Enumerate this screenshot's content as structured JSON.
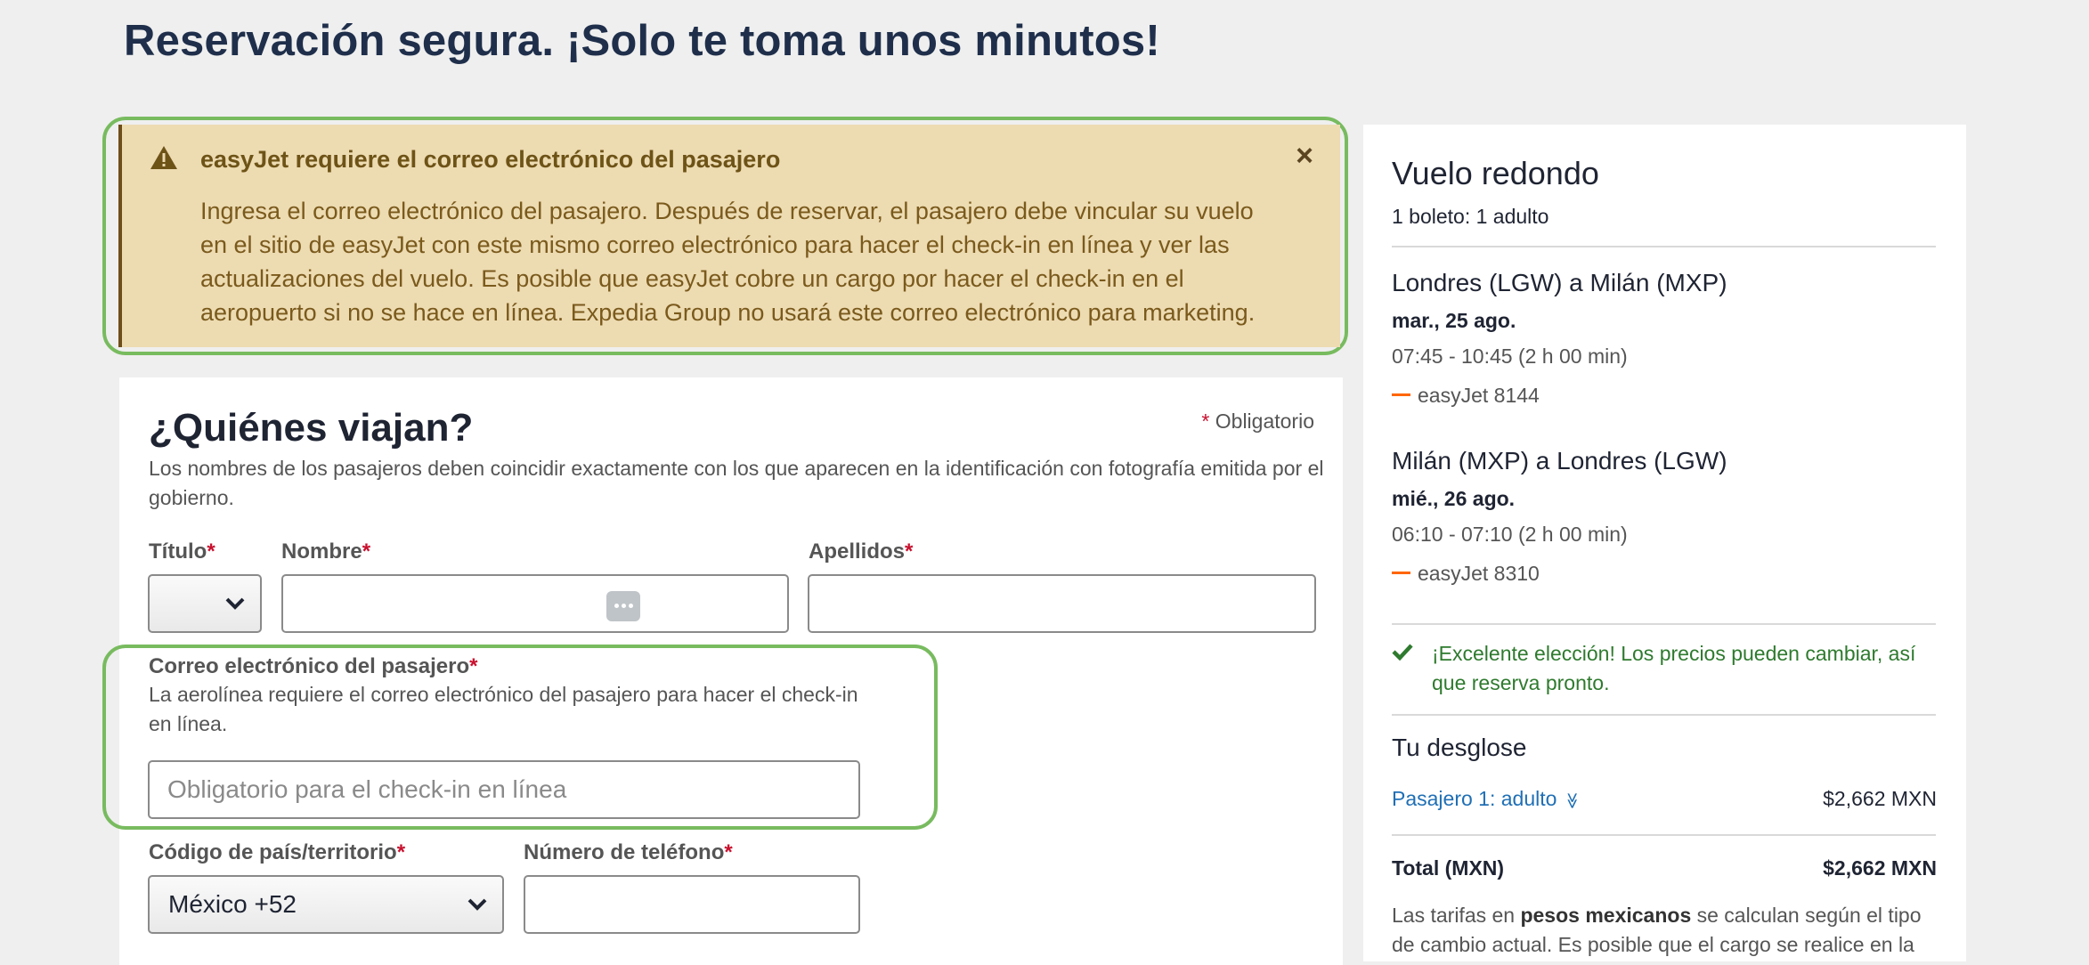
{
  "page": {
    "title": "Reservación segura. ¡Solo te toma unos minutos!"
  },
  "alert": {
    "icon": "warning-icon",
    "title": "easyJet requiere el correo electrónico del pasajero",
    "body": "Ingresa el correo electrónico del pasajero. Después de reservar, el pasajero debe vincular su vuelo en el sitio de easyJet con este mismo correo electrónico para hacer el check-in en línea y ver las actualizaciones del vuelo. Es posible que easyJet cobre un cargo por hacer el check-in en el aeropuerto si no se hace en línea. Expedia Group no usará este correo electrónico para marketing.",
    "close_label": "×",
    "colors": {
      "background": "#eddbb2",
      "text": "#7a5a1c",
      "highlight": "#78bb5f"
    }
  },
  "travelers": {
    "heading": "¿Quiénes viajan?",
    "required_star": "*",
    "required_label": "Obligatorio",
    "intro": "Los nombres de los pasajeros deben coincidir exactamente con los que aparecen en la identificación con fotografía emitida por el gobierno.",
    "title_label": "Título",
    "title_value": "",
    "first_name_label": "Nombre",
    "first_name_value": "",
    "last_name_label": "Apellidos",
    "last_name_value": "",
    "email_label": "Correo electrónico del pasajero",
    "email_help": "La aerolínea requiere el correo electrónico del pasajero para hacer el check-in en línea.",
    "email_placeholder": "Obligatorio para el check-in en línea",
    "email_value": "",
    "country_code_label": "Código de país/territorio",
    "country_code_value": "México +52",
    "phone_label": "Número de teléfono",
    "phone_value": ""
  },
  "summary": {
    "title": "Vuelo redondo",
    "tickets": "1 boleto: 1 adulto",
    "legs": [
      {
        "route": "Londres (LGW) a Milán (MXP)",
        "date": "mar., 25 ago.",
        "time": "07:45 - 10:45 (2 h 00 min)",
        "airline": "easyJet 8144"
      },
      {
        "route": "Milán (MXP) a Londres (LGW)",
        "date": "mié., 26 ago.",
        "time": "06:10 - 07:10 (2 h 00 min)",
        "airline": "easyJet 8310"
      }
    ],
    "promo": "¡Excelente elección! Los precios pueden cambiar, así que reserva pronto.",
    "breakdown_title": "Tu desglose",
    "passenger_link": "Pasajero 1: adulto",
    "passenger_price": "$2,662 MXN",
    "total_label": "Total (MXN)",
    "total_price": "$2,662 MXN",
    "rates_note_prefix": "Las tarifas en ",
    "rates_note_bold": "pesos mexicanos",
    "rates_note_suffix": " se calculan según el tipo de cambio actual. Es posible que el cargo se realice en la"
  }
}
